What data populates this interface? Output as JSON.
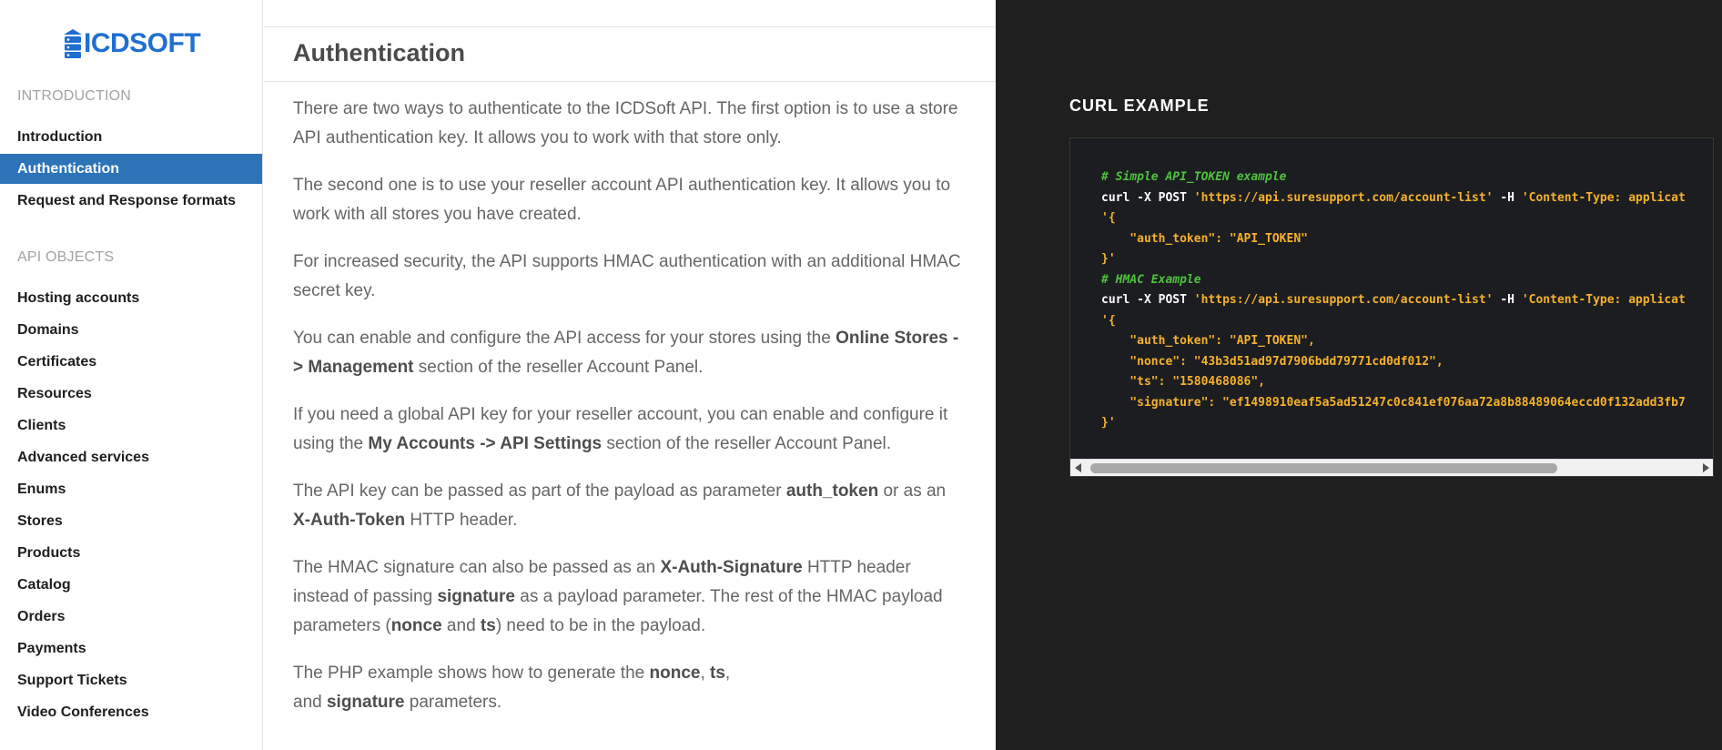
{
  "brand": {
    "name": "ICDSOFT",
    "color": "#1f6fd1"
  },
  "sidebar": {
    "sections": [
      {
        "title": "INTRODUCTION",
        "items": [
          {
            "label": "Introduction",
            "active": false
          },
          {
            "label": "Authentication",
            "active": true
          },
          {
            "label": "Request and Response formats",
            "active": false
          }
        ]
      },
      {
        "title": "API OBJECTS",
        "items": [
          {
            "label": "Hosting accounts"
          },
          {
            "label": "Domains"
          },
          {
            "label": "Certificates"
          },
          {
            "label": "Resources"
          },
          {
            "label": "Clients"
          },
          {
            "label": "Advanced services"
          },
          {
            "label": "Enums"
          },
          {
            "label": "Stores"
          },
          {
            "label": "Products"
          },
          {
            "label": "Catalog"
          },
          {
            "label": "Orders"
          },
          {
            "label": "Payments"
          },
          {
            "label": "Support Tickets"
          },
          {
            "label": "Video Conferences"
          }
        ]
      }
    ],
    "active_color": "#2d73b8"
  },
  "main": {
    "title": "Authentication",
    "paragraphs": [
      {
        "parts": [
          {
            "t": "There are two ways to authenticate to the ICDSoft API. The first option is to use a store API authentication key. It allows you to work with that store only."
          }
        ]
      },
      {
        "parts": [
          {
            "t": "The second one is to use your reseller account API authentication key. It allows you to work with all stores you have created."
          }
        ]
      },
      {
        "parts": [
          {
            "t": "For increased security, the API supports HMAC authentication with an additional HMAC secret key."
          }
        ]
      },
      {
        "parts": [
          {
            "t": "You can enable and configure the API access for your stores using the "
          },
          {
            "t": "Online Stores -> Management",
            "b": true
          },
          {
            "t": " section of the reseller Account Panel."
          }
        ]
      },
      {
        "parts": [
          {
            "t": "If you need a global API key for your reseller account, you can enable and configure it using the "
          },
          {
            "t": "My Accounts -> API Settings",
            "b": true
          },
          {
            "t": " section of the reseller Account Panel."
          }
        ]
      },
      {
        "parts": [
          {
            "t": "The API key can be passed as part of the payload as parameter "
          },
          {
            "t": "auth_token",
            "b": true
          },
          {
            "t": " or as an "
          },
          {
            "t": "X-Auth-Token",
            "b": true
          },
          {
            "t": " HTTP header."
          }
        ]
      },
      {
        "parts": [
          {
            "t": "The HMAC signature can also be passed as an "
          },
          {
            "t": "X-Auth-Signature",
            "b": true
          },
          {
            "t": " HTTP header instead of passing "
          },
          {
            "t": "signature",
            "b": true
          },
          {
            "t": " as a payload parameter. The rest of the HMAC payload parameters ("
          },
          {
            "t": "nonce",
            "b": true
          },
          {
            "t": " and "
          },
          {
            "t": "ts",
            "b": true
          },
          {
            "t": ") need to be in the payload."
          }
        ]
      },
      {
        "parts": [
          {
            "t": "The PHP example shows how to generate the "
          },
          {
            "t": "nonce",
            "b": true
          },
          {
            "t": ", "
          },
          {
            "t": "ts",
            "b": true
          },
          {
            "t": ",\nand "
          },
          {
            "t": "signature",
            "b": true
          },
          {
            "t": " parameters."
          }
        ]
      }
    ]
  },
  "code_panel": {
    "heading": "CURL EXAMPLE",
    "lines": [
      [
        {
          "t": "# Simple API_TOKEN example",
          "k": "comment"
        }
      ],
      [
        {
          "t": "curl",
          "k": "cmd"
        },
        {
          "t": " -X POST ",
          "k": "flag"
        },
        {
          "t": "'https://api.suresupport.com/account-list'",
          "k": "str"
        },
        {
          "t": " -H ",
          "k": "flag"
        },
        {
          "t": "'Content-Type: applicat",
          "k": "str"
        }
      ],
      [
        {
          "t": "'{",
          "k": "str"
        }
      ],
      [
        {
          "t": "    \"auth_token\": \"API_TOKEN\"",
          "k": "str"
        }
      ],
      [
        {
          "t": "}'",
          "k": "str"
        }
      ],
      [
        {
          "t": "# HMAC Example",
          "k": "comment"
        }
      ],
      [
        {
          "t": "curl",
          "k": "cmd"
        },
        {
          "t": " -X POST ",
          "k": "flag"
        },
        {
          "t": "'https://api.suresupport.com/account-list'",
          "k": "str"
        },
        {
          "t": " -H ",
          "k": "flag"
        },
        {
          "t": "'Content-Type: applicat",
          "k": "str"
        }
      ],
      [
        {
          "t": "'{",
          "k": "str"
        }
      ],
      [
        {
          "t": "    \"auth_token\": \"API_TOKEN\",",
          "k": "str"
        }
      ],
      [
        {
          "t": "    \"nonce\": \"43b3d51ad97d7906bdd79771cd0df012\",",
          "k": "str"
        }
      ],
      [
        {
          "t": "    \"ts\": \"1580468086\",",
          "k": "str"
        }
      ],
      [
        {
          "t": "    \"signature\": \"ef1498910eaf5a5ad51247c0c841ef076aa72a8b88489064eccd0f132add3fb7",
          "k": "str"
        }
      ],
      [
        {
          "t": "}'",
          "k": "str"
        }
      ]
    ],
    "colors": {
      "background": "#1f1f1f",
      "string": "#f5b12c",
      "comment": "#4ec23d"
    },
    "scroll_fraction": 0.72
  }
}
